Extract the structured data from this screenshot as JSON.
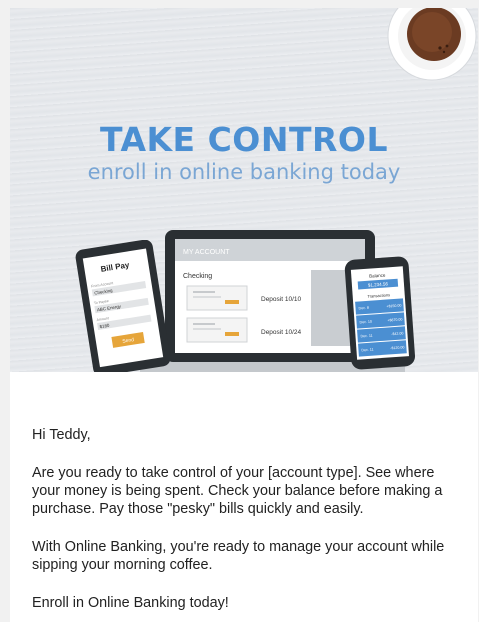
{
  "hero": {
    "headline": "TAKE CONTROL",
    "subline": "enroll in online banking today",
    "tablet": {
      "title": "Bill Pay",
      "from_label": "From Account",
      "from_value": "Checking",
      "to_label": "To Payee",
      "to_value": "ABC Energy",
      "amount_label": "Amount",
      "amount_value": "$180",
      "send_label": "Send"
    },
    "laptop": {
      "header": "MY ACCOUNT",
      "section": "Checking",
      "deposits": [
        "Deposit 10/10",
        "Deposit 10/24"
      ]
    },
    "phone": {
      "balance_label": "Balance",
      "balance_value": "$1,234.56",
      "transactions_label": "Transactions",
      "rows": [
        {
          "date": "Dec. 8",
          "amount": "+$150.00"
        },
        {
          "date": "Dec. 10",
          "amount": "+$870.00"
        },
        {
          "date": "Dec. 11",
          "amount": "-$42.00"
        },
        {
          "date": "Dec. 11",
          "amount": "-$120.00"
        }
      ]
    }
  },
  "email": {
    "greeting": "Hi Teddy,",
    "paragraph1": "Are you ready to take control of your [account type]. See where your money is being spent. Check your balance before making a purchase. Pay those \"pesky\" bills quickly and easily.",
    "paragraph2": "With Online Banking, you're ready to manage your account while sipping your morning coffee.",
    "paragraph3": "Enroll in Online Banking today!"
  }
}
